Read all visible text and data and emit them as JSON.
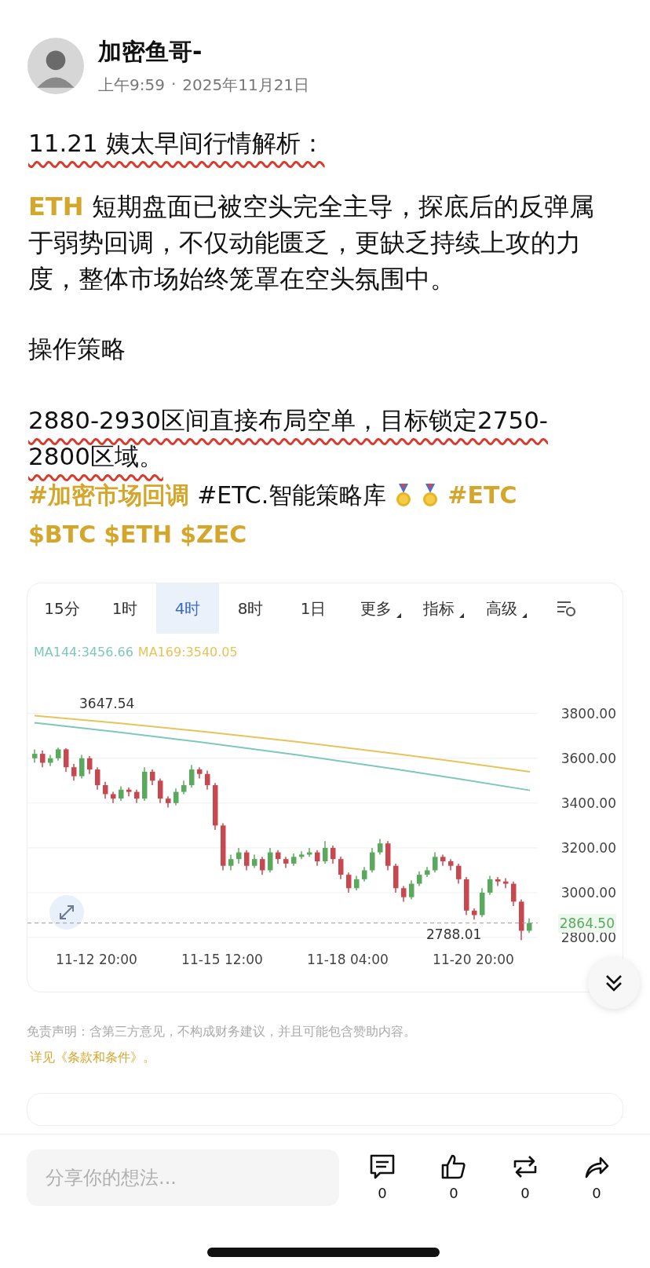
{
  "post": {
    "author": "加密鱼哥-",
    "time": "上午9:59",
    "separator": "·",
    "date": "2025年11月21日"
  },
  "content": {
    "title": {
      "text": "11.21 姨太早间行情解析：",
      "underlined": true
    },
    "body": {
      "coin": "ETH",
      "text": " 短期盘面已被空头完全主导，探底后的反弹属于弱势回调，不仅动能匮乏，更缺乏持续上攻的力度，整体市场始终笼罩在空头氛围中。"
    },
    "heading": "操作策略",
    "strategy": {
      "text": "2880-2930区间直接布局空单，目标锁定2750-2800区域。",
      "underlined": true
    },
    "tags": [
      {
        "kind": "link",
        "text": "#加密市场回调"
      },
      {
        "kind": "plain",
        "text": "#ETC.智能策略库"
      },
      {
        "kind": "medal"
      },
      {
        "kind": "medal"
      },
      {
        "kind": "link",
        "text": "#ETC"
      },
      {
        "kind": "break"
      },
      {
        "kind": "link",
        "text": "$BTC"
      },
      {
        "kind": "link",
        "text": "$ETH"
      },
      {
        "kind": "link",
        "text": "$ZEC"
      }
    ]
  },
  "chart": {
    "tabs": [
      {
        "label": "15分",
        "selected": false,
        "kind": "plain"
      },
      {
        "label": "1时",
        "selected": false,
        "kind": "plain"
      },
      {
        "label": "4时",
        "selected": true,
        "kind": "plain"
      },
      {
        "label": "8时",
        "selected": false,
        "kind": "plain"
      },
      {
        "label": "1日",
        "selected": false,
        "kind": "plain"
      },
      {
        "label": "更多",
        "selected": false,
        "kind": "dropdown"
      },
      {
        "label": "指标",
        "selected": false,
        "kind": "dropdown"
      },
      {
        "label": "高级",
        "selected": false,
        "kind": "dropdown"
      }
    ],
    "ma_legend": [
      {
        "text": "MA144:3456.66",
        "color": "#7ec8b8"
      },
      {
        "text": "MA169:3540.05",
        "color": "#e8c25a"
      }
    ],
    "x_axis_labels": [
      "11-12 20:00",
      "11-15 12:00",
      "11-18 04:00",
      "11-20 20:00"
    ],
    "high_label": "3647.54",
    "low_label": "2788.01",
    "last_price": "2864.50",
    "chart_data": {
      "type": "candlestick",
      "grid": true,
      "ylim": [
        2800,
        3800
      ],
      "yticks": [
        {
          "value": 3800,
          "label": "3800.00"
        },
        {
          "value": 3600,
          "label": "3600.00"
        },
        {
          "value": 3400,
          "label": "3400.00"
        },
        {
          "value": 3200,
          "label": "3200.00"
        },
        {
          "value": 3000,
          "label": "3000.00"
        },
        {
          "value": 2800,
          "label": "2800.00"
        }
      ],
      "ohlc": [
        [
          3600,
          3640,
          3580,
          3620
        ],
        [
          3620,
          3635,
          3560,
          3580
        ],
        [
          3580,
          3615,
          3565,
          3600
        ],
        [
          3600,
          3647.54,
          3590,
          3640
        ],
        [
          3640,
          3645,
          3540,
          3560
        ],
        [
          3560,
          3575,
          3500,
          3520
        ],
        [
          3520,
          3615,
          3510,
          3600
        ],
        [
          3600,
          3610,
          3530,
          3550
        ],
        [
          3550,
          3560,
          3460,
          3480
        ],
        [
          3480,
          3495,
          3420,
          3440
        ],
        [
          3440,
          3450,
          3400,
          3420
        ],
        [
          3420,
          3475,
          3410,
          3460
        ],
        [
          3460,
          3470,
          3430,
          3450
        ],
        [
          3450,
          3460,
          3400,
          3420
        ],
        [
          3420,
          3560,
          3410,
          3540
        ],
        [
          3540,
          3550,
          3480,
          3500
        ],
        [
          3500,
          3510,
          3400,
          3420
        ],
        [
          3420,
          3430,
          3380,
          3400
        ],
        [
          3400,
          3465,
          3390,
          3450
        ],
        [
          3450,
          3500,
          3440,
          3480
        ],
        [
          3480,
          3570,
          3470,
          3550
        ],
        [
          3550,
          3560,
          3510,
          3530
        ],
        [
          3530,
          3545,
          3460,
          3480
        ],
        [
          3480,
          3490,
          3280,
          3300
        ],
        [
          3300,
          3310,
          3100,
          3120
        ],
        [
          3120,
          3170,
          3100,
          3150
        ],
        [
          3150,
          3200,
          3130,
          3180
        ],
        [
          3180,
          3190,
          3100,
          3120
        ],
        [
          3120,
          3170,
          3110,
          3150
        ],
        [
          3150,
          3160,
          3080,
          3100
        ],
        [
          3100,
          3200,
          3090,
          3180
        ],
        [
          3180,
          3190,
          3130,
          3150
        ],
        [
          3150,
          3160,
          3110,
          3130
        ],
        [
          3130,
          3175,
          3120,
          3160
        ],
        [
          3160,
          3185,
          3150,
          3170
        ],
        [
          3170,
          3200,
          3160,
          3180
        ],
        [
          3180,
          3190,
          3120,
          3140
        ],
        [
          3140,
          3230,
          3130,
          3200
        ],
        [
          3200,
          3210,
          3130,
          3150
        ],
        [
          3150,
          3160,
          3060,
          3080
        ],
        [
          3080,
          3090,
          3000,
          3020
        ],
        [
          3020,
          3075,
          3010,
          3060
        ],
        [
          3060,
          3115,
          3050,
          3100
        ],
        [
          3100,
          3200,
          3090,
          3180
        ],
        [
          3180,
          3240,
          3170,
          3220
        ],
        [
          3220,
          3230,
          3100,
          3120
        ],
        [
          3120,
          3130,
          3000,
          3020
        ],
        [
          3020,
          3030,
          2960,
          2980
        ],
        [
          2980,
          3055,
          2970,
          3040
        ],
        [
          3040,
          3095,
          3030,
          3080
        ],
        [
          3080,
          3115,
          3070,
          3100
        ],
        [
          3100,
          3180,
          3090,
          3160
        ],
        [
          3160,
          3170,
          3120,
          3140
        ],
        [
          3140,
          3150,
          3100,
          3120
        ],
        [
          3120,
          3130,
          3040,
          3060
        ],
        [
          3060,
          3070,
          2900,
          2920
        ],
        [
          2920,
          2930,
          2880,
          2900
        ],
        [
          2900,
          3020,
          2890,
          3000
        ],
        [
          3000,
          3075,
          2990,
          3060
        ],
        [
          3060,
          3070,
          3030,
          3050
        ],
        [
          3050,
          3065,
          3020,
          3040
        ],
        [
          3040,
          3050,
          2940,
          2960
        ],
        [
          2960,
          2970,
          2788.01,
          2830
        ],
        [
          2830,
          2885,
          2820,
          2864.5
        ]
      ]
    },
    "kind": "candles"
  },
  "disclaimer": {
    "text": "免责声明：含第三方意见，不构成财务建议，并且可能包含赞助内容。",
    "link": "详见《条款和条件》。"
  },
  "bottom_bar": {
    "placeholder": "分享你的想法...",
    "actions": [
      {
        "kind": "comment",
        "count": "0"
      },
      {
        "kind": "like",
        "count": "0"
      },
      {
        "kind": "repost",
        "count": "0"
      },
      {
        "kind": "share",
        "count": "0"
      }
    ]
  }
}
